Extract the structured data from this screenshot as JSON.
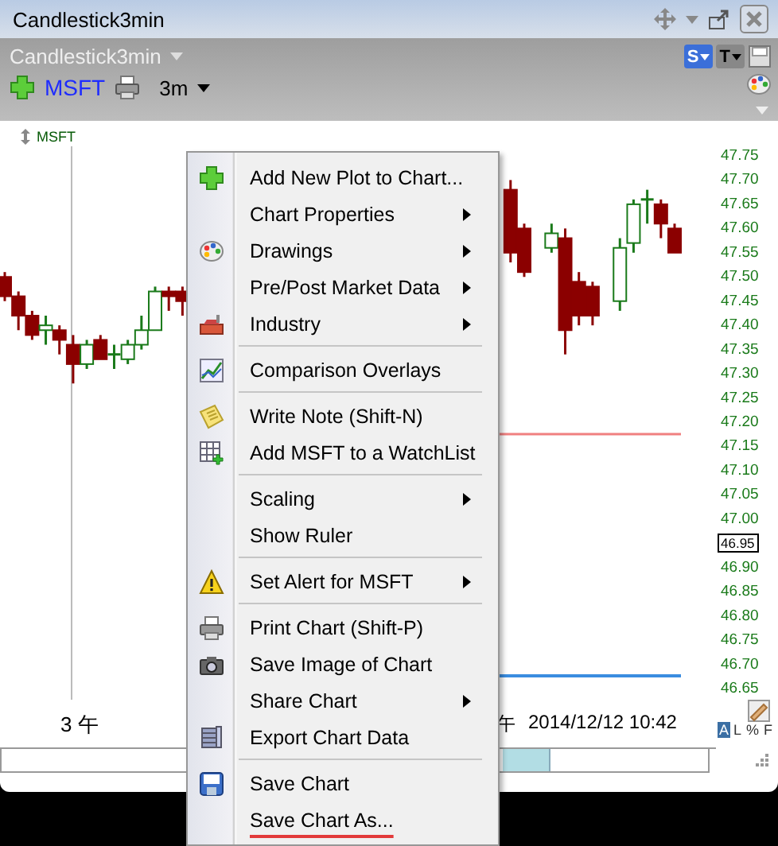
{
  "window": {
    "title": "Candlestick3min"
  },
  "toolbar": {
    "chart_name": "Candlestick3min",
    "symbol": "MSFT",
    "interval": "3m",
    "buttons": [
      {
        "label": "S",
        "kind": "study"
      },
      {
        "label": "T",
        "kind": "tool"
      }
    ]
  },
  "chart": {
    "symbol": "MSFT",
    "current_price": "46.95",
    "chart_data": {
      "type": "candlestick",
      "ylim": [
        46.65,
        47.75
      ],
      "yticks": [
        {
          "value": 47.75,
          "label": "47.75"
        },
        {
          "value": 47.7,
          "label": "47.70"
        },
        {
          "value": 47.65,
          "label": "47.65"
        },
        {
          "value": 47.6,
          "label": "47.60"
        },
        {
          "value": 47.55,
          "label": "47.55"
        },
        {
          "value": 47.5,
          "label": "47.50"
        },
        {
          "value": 47.45,
          "label": "47.45"
        },
        {
          "value": 47.4,
          "label": "47.40"
        },
        {
          "value": 47.35,
          "label": "47.35"
        },
        {
          "value": 47.3,
          "label": "47.30"
        },
        {
          "value": 47.25,
          "label": "47.25"
        },
        {
          "value": 47.2,
          "label": "47.20"
        },
        {
          "value": 47.15,
          "label": "47.15"
        },
        {
          "value": 47.1,
          "label": "47.10"
        },
        {
          "value": 47.05,
          "label": "47.05"
        },
        {
          "value": 47.0,
          "label": "47.00"
        },
        {
          "value": 46.9,
          "label": "46.90"
        },
        {
          "value": 46.85,
          "label": "46.85"
        },
        {
          "value": 46.8,
          "label": "46.80"
        },
        {
          "value": 46.75,
          "label": "46.75"
        },
        {
          "value": 46.7,
          "label": "46.70"
        },
        {
          "value": 46.65,
          "label": "46.65"
        }
      ],
      "categories": [
        null,
        null,
        null,
        null,
        null,
        null,
        null,
        null,
        null,
        null,
        null,
        null,
        null,
        null,
        null,
        null,
        null,
        null,
        null,
        null,
        null,
        null,
        null,
        null,
        null,
        null,
        null,
        null,
        null,
        null,
        null,
        null,
        null,
        null,
        null,
        null,
        null,
        null,
        null,
        null,
        null,
        null,
        null,
        null,
        null,
        null,
        null,
        null,
        null,
        null
      ],
      "ohlc": [
        [
          47.5,
          47.51,
          47.45,
          47.46
        ],
        [
          47.46,
          47.47,
          47.39,
          47.42
        ],
        [
          47.42,
          47.43,
          47.37,
          47.38
        ],
        [
          47.39,
          47.42,
          47.36,
          47.4
        ],
        [
          47.39,
          47.4,
          47.34,
          47.37
        ],
        [
          47.36,
          47.38,
          47.28,
          47.32
        ],
        [
          47.32,
          47.37,
          47.31,
          47.36
        ],
        [
          47.37,
          47.38,
          47.33,
          47.33
        ],
        [
          47.34,
          47.36,
          47.31,
          47.34
        ],
        [
          47.33,
          47.37,
          47.32,
          47.36
        ],
        [
          47.36,
          47.42,
          47.35,
          47.39
        ],
        [
          47.39,
          47.48,
          47.39,
          47.47
        ],
        [
          47.47,
          47.48,
          47.43,
          47.46
        ],
        [
          47.47,
          47.48,
          47.42,
          47.45
        ],
        null,
        null,
        null,
        null,
        null,
        null,
        null,
        null,
        null,
        null,
        null,
        null,
        null,
        null,
        null,
        null,
        null,
        null,
        null,
        null,
        null,
        null,
        null,
        [
          47.68,
          47.7,
          47.53,
          47.55
        ],
        [
          47.6,
          47.61,
          47.5,
          47.51
        ],
        null,
        [
          47.56,
          47.61,
          47.55,
          47.59
        ],
        [
          47.58,
          47.6,
          47.34,
          47.39
        ],
        [
          47.49,
          47.51,
          47.4,
          47.42
        ],
        [
          47.48,
          47.49,
          47.4,
          47.42
        ],
        null,
        [
          47.45,
          47.58,
          47.43,
          47.56
        ],
        [
          47.57,
          47.66,
          47.55,
          47.65
        ],
        [
          47.66,
          47.68,
          47.61,
          47.66
        ],
        [
          47.65,
          47.66,
          47.58,
          47.61
        ],
        [
          47.6,
          47.61,
          47.55,
          47.55
        ]
      ]
    },
    "time_axis": [
      "3 午",
      "午",
      "2014/12/12 10:42"
    ],
    "scale_modes": [
      {
        "label": "A",
        "selected": true
      },
      {
        "label": "L",
        "selected": false
      },
      {
        "label": "%",
        "selected": false
      },
      {
        "label": "F",
        "selected": false
      }
    ]
  },
  "context_menu": [
    {
      "kind": "item",
      "label": "Add New Plot to Chart...",
      "submenu": false
    },
    {
      "kind": "item",
      "label": "Chart Properties",
      "submenu": true
    },
    {
      "kind": "item",
      "label": "Drawings",
      "submenu": true
    },
    {
      "kind": "item",
      "label": "Pre/Post Market Data",
      "submenu": true
    },
    {
      "kind": "item",
      "label": "Industry",
      "submenu": true
    },
    {
      "kind": "separator"
    },
    {
      "kind": "item",
      "label": "Comparison Overlays",
      "submenu": false
    },
    {
      "kind": "separator"
    },
    {
      "kind": "item",
      "label": "Write Note (Shift-N)",
      "submenu": false
    },
    {
      "kind": "item",
      "label": "Add MSFT to a WatchList",
      "submenu": false
    },
    {
      "kind": "separator"
    },
    {
      "kind": "item",
      "label": "Scaling",
      "submenu": true
    },
    {
      "kind": "item",
      "label": "Show Ruler",
      "submenu": false
    },
    {
      "kind": "separator"
    },
    {
      "kind": "item",
      "label": "Set Alert for MSFT",
      "submenu": true
    },
    {
      "kind": "separator"
    },
    {
      "kind": "item",
      "label": "Print Chart (Shift-P)",
      "submenu": false
    },
    {
      "kind": "item",
      "label": "Save Image of Chart",
      "submenu": false
    },
    {
      "kind": "item",
      "label": "Share Chart",
      "submenu": true
    },
    {
      "kind": "item",
      "label": "Export Chart Data",
      "submenu": false
    },
    {
      "kind": "separator"
    },
    {
      "kind": "item",
      "label": "Save Chart",
      "submenu": false
    },
    {
      "kind": "item",
      "label": "Save Chart As...",
      "submenu": false,
      "underlined": true
    }
  ]
}
